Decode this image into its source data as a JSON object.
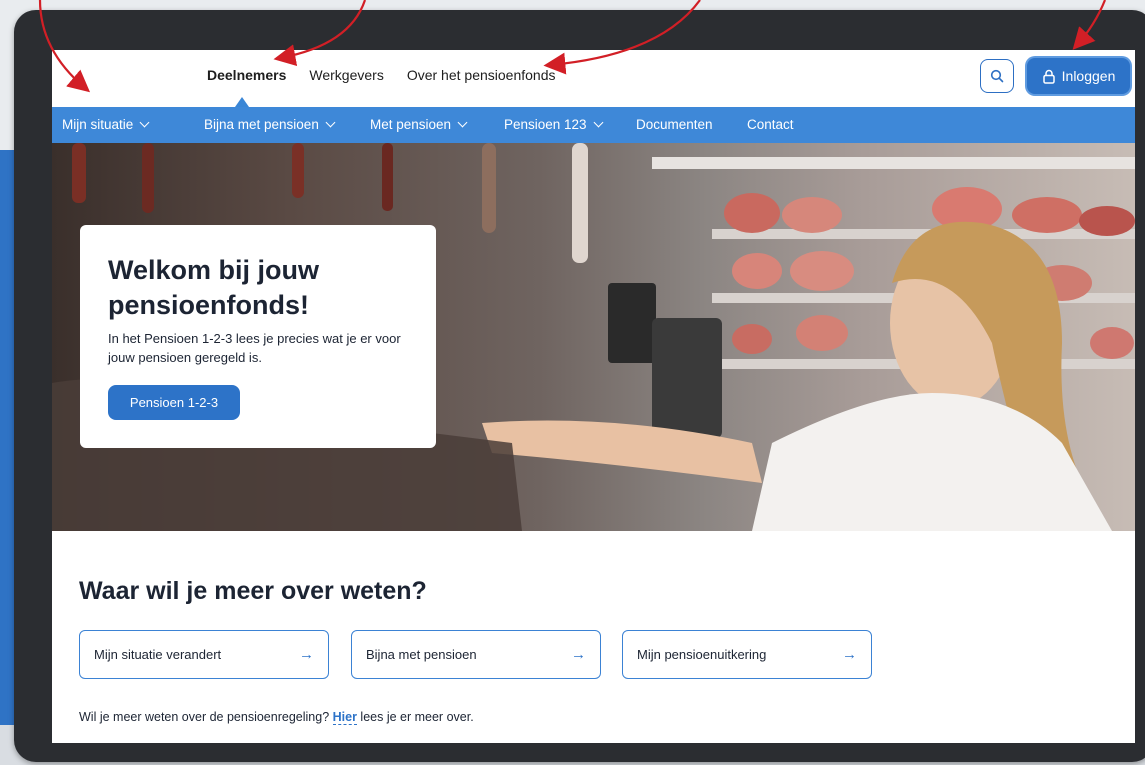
{
  "topnav": {
    "links": [
      "Deelnemers",
      "Werkgevers",
      "Over het pensioenfonds"
    ],
    "active_index": 0,
    "search_icon": "search-icon",
    "login_label": "Inloggen",
    "login_icon": "lock-icon"
  },
  "menu": {
    "items": [
      {
        "label": "Mijn situatie",
        "has_dropdown": true
      },
      {
        "label": "Bijna met pensioen",
        "has_dropdown": true
      },
      {
        "label": "Met pensioen",
        "has_dropdown": true
      },
      {
        "label": "Pensioen 123",
        "has_dropdown": true
      },
      {
        "label": "Documenten",
        "has_dropdown": false
      },
      {
        "label": "Contact",
        "has_dropdown": false
      }
    ]
  },
  "hero": {
    "title": "Welkom bij jouw pensioenfonds!",
    "text": "In het Pensioen 1-2-3 lees je precies wat je er voor jouw pensioen geregeld is.",
    "button_label": "Pensioen 1-2-3"
  },
  "section": {
    "title": "Waar wil je meer over weten?",
    "cards": [
      {
        "label": "Mijn situatie verandert"
      },
      {
        "label": "Bijna met pensioen"
      },
      {
        "label": "Mijn pensioenuitkering"
      }
    ],
    "footnote_before": "Wil je meer weten over de pensioenregeling? ",
    "footnote_link": "Hier",
    "footnote_after": " lees je er meer over."
  },
  "colors": {
    "brand_blue": "#2d73c8",
    "menu_blue": "#3e88d8",
    "annotation_red": "#d21f26"
  }
}
